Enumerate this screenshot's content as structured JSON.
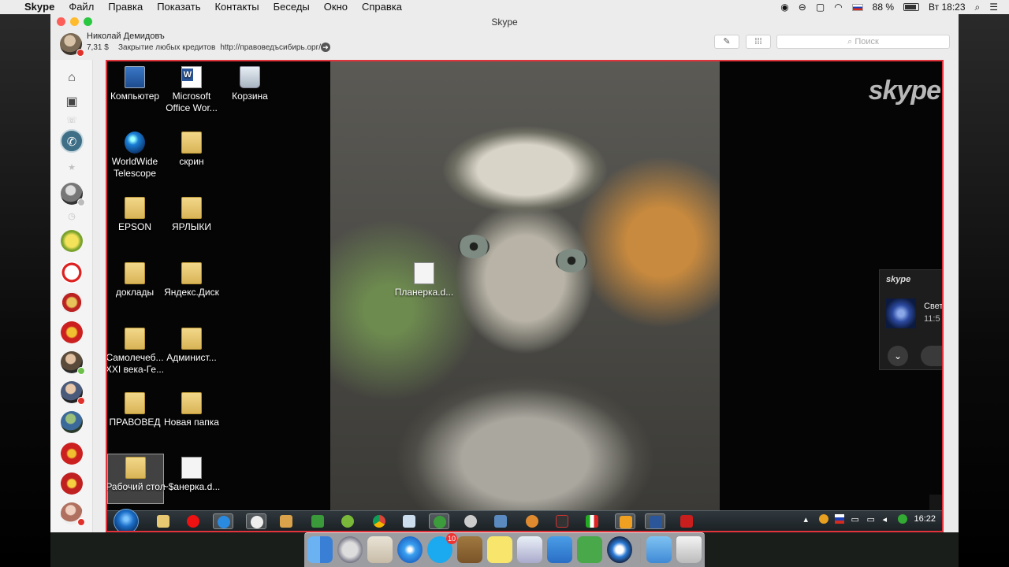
{
  "menubar": {
    "app": "Skype",
    "items": [
      "Файл",
      "Правка",
      "Показать",
      "Контакты",
      "Беседы",
      "Окно",
      "Справка"
    ],
    "battery": "88 %",
    "clock": "Вт 18:23"
  },
  "window": {
    "title": "Skype"
  },
  "profile": {
    "name": "Николай Демидовъ",
    "credit": "7,31 $",
    "mood_text": "Закрытие любых кредитов",
    "mood_url": "http://правоведъсибирь.орг/"
  },
  "toolbar": {
    "compose_icon": "compose-icon",
    "dialpad_icon": "dialpad-icon",
    "search_placeholder": "Поиск"
  },
  "desktop": {
    "icons": [
      {
        "label": "Компьютер",
        "icon": "computer"
      },
      {
        "label": "Microsoft Office Wor...",
        "icon": "word"
      },
      {
        "label": "Корзина",
        "icon": "recycle-bin"
      },
      {
        "label": "WorldWide Telescope",
        "icon": "globe"
      },
      {
        "label": "скрин",
        "icon": "folder"
      },
      {
        "label": "EPSON",
        "icon": "folder"
      },
      {
        "label": "ЯРЛЫКИ",
        "icon": "folder"
      },
      {
        "label": "доклады",
        "icon": "folder"
      },
      {
        "label": "Яндекс.Диск",
        "icon": "folder"
      },
      {
        "label": "Самолечеб... XXI века-Ге...",
        "icon": "folder"
      },
      {
        "label": "Админист...",
        "icon": "folder"
      },
      {
        "label": "ПРАВОВЕД",
        "icon": "folder"
      },
      {
        "label": "Новая папка",
        "icon": "folder"
      },
      {
        "label": "Рабочий стол",
        "icon": "folder"
      },
      {
        "label": "~$анерка.d...",
        "icon": "document"
      },
      {
        "label": "Планерка.d...",
        "icon": "document"
      }
    ],
    "skype_watermark": "skype",
    "notification": {
      "header": "skype",
      "line1": "Свет",
      "line2": "11:5"
    },
    "taskbar_clock": "16:22"
  },
  "colors": {
    "share_border": "#e2323c",
    "call_button": "#3f6f86"
  },
  "dock": {
    "skype_badge": "10"
  }
}
